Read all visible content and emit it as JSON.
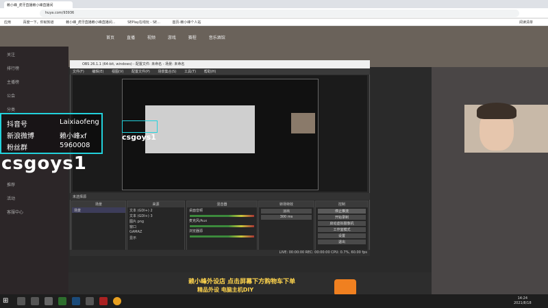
{
  "browser": {
    "tab_title": "赖小峰_虎牙直播赖小峰直播间",
    "url": "huya.com/93936",
    "bookmarks": [
      "应用",
      "百度一下，你就知道",
      "赖小峰_虎牙直播赖小峰直播间...",
      "SEPlay在线玩 - SE...",
      "首页-赖小峰个人站",
      "阅读清单"
    ]
  },
  "site": {
    "nav": [
      "首页",
      "直播",
      "视频",
      "游戏",
      "赛程",
      "音乐酒馆"
    ],
    "sidebar": [
      "关注",
      "排行榜",
      "主播榜",
      "公会",
      "分类",
      "推荐",
      "活动",
      "客服中心"
    ]
  },
  "obs": {
    "title": "OBS 26.1.1 (64-bit, windows) - 配置文件: 未命名 - 场景: 未命名",
    "menu": [
      "文件(F)",
      "编辑(E)",
      "视图(V)",
      "配置文件(P)",
      "场景集合(S)",
      "工具(T)",
      "帮助(H)"
    ],
    "label_bar": "未选择源",
    "docks": {
      "scenes": "场景",
      "sources": "来源",
      "mixer": "混音器",
      "transitions": "转场特效",
      "controls": "控制"
    },
    "scenes": [
      "场景"
    ],
    "sources": [
      "文本 (GDI+) 2",
      "文本 (GDI+) 3",
      "图片.png",
      "窗口",
      "GAMAZ",
      "显示"
    ],
    "mixer": [
      "桌面音频",
      "麦克风/Aux",
      "浏览器源"
    ],
    "transition": "淡出",
    "duration": "300 ms",
    "controls": [
      "停止推流",
      "开始录制",
      "启动虚拟摄像机",
      "工作室模式",
      "设置",
      "退出"
    ],
    "status": "LIVE: 00:00:00   REC: 00:00:00   CPU: 0.7%, 60.00 fps"
  },
  "overlay": {
    "rows": [
      {
        "label": "抖音号",
        "value": "Laixiaofeng"
      },
      {
        "label": "新浪微博",
        "value": "赖小峰xf"
      },
      {
        "label": "粉丝群",
        "value": "5960008"
      }
    ],
    "name": "csgoys1"
  },
  "promo": {
    "line1": "赖小峰外设店 点击屏幕下方购物车下单",
    "line2": "精品外设 电脑主机DIY"
  },
  "taskbar": {
    "time": "14:24",
    "date": "2021/8/18"
  },
  "colors": {
    "overlay_border": "#22d3dd",
    "promo_text": "#ffd44d"
  }
}
